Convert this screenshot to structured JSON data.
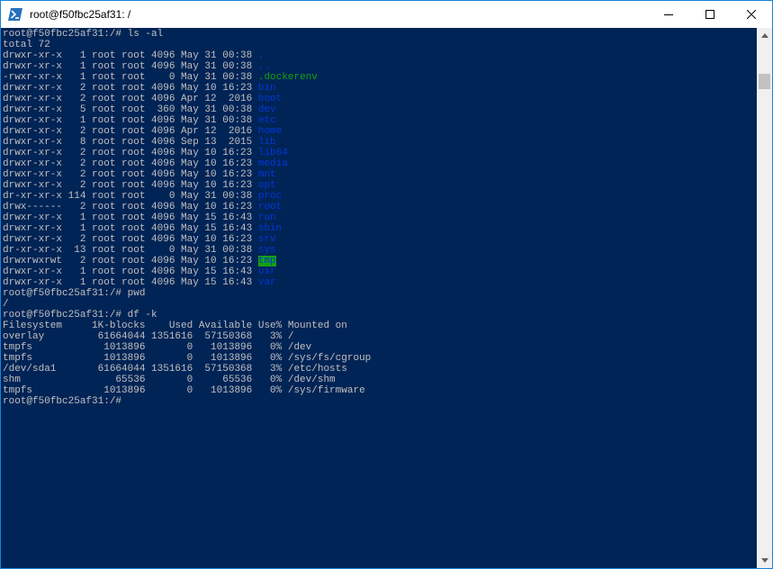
{
  "window": {
    "title": "root@f50fbc25af31: /"
  },
  "icons": {
    "app": "powershell-icon",
    "minimize": "minimize-icon",
    "maximize": "maximize-icon",
    "close": "close-icon",
    "scroll_up": "scroll-up-arrow-icon",
    "scroll_down": "scroll-down-arrow-icon"
  },
  "colors": {
    "terminal_bg": "#012456",
    "text": "#c0c0c0",
    "dir": "#0037da",
    "file": "#13a10e",
    "sticky_bg": "#13a10e"
  },
  "terminal": {
    "lines": [
      [
        "root@f50fbc25af31:/# ls -al"
      ],
      [
        "total 72"
      ],
      [
        "drwxr-xr-x   1 root root 4096 May 31 00:38 ",
        "."
      ],
      [
        "drwxr-xr-x   1 root root 4096 May 31 00:38 ",
        ".."
      ],
      [
        "-rwxr-xr-x   1 root root    0 May 31 00:38 ",
        ".dockerenv"
      ],
      [
        "drwxr-xr-x   2 root root 4096 May 10 16:23 ",
        "bin"
      ],
      [
        "drwxr-xr-x   2 root root 4096 Apr 12  2016 ",
        "boot"
      ],
      [
        "drwxr-xr-x   5 root root  360 May 31 00:38 ",
        "dev"
      ],
      [
        "drwxr-xr-x   1 root root 4096 May 31 00:38 ",
        "etc"
      ],
      [
        "drwxr-xr-x   2 root root 4096 Apr 12  2016 ",
        "home"
      ],
      [
        "drwxr-xr-x   8 root root 4096 Sep 13  2015 ",
        "lib"
      ],
      [
        "drwxr-xr-x   2 root root 4096 May 10 16:23 ",
        "lib64"
      ],
      [
        "drwxr-xr-x   2 root root 4096 May 10 16:23 ",
        "media"
      ],
      [
        "drwxr-xr-x   2 root root 4096 May 10 16:23 ",
        "mnt"
      ],
      [
        "drwxr-xr-x   2 root root 4096 May 10 16:23 ",
        "opt"
      ],
      [
        "dr-xr-xr-x 114 root root    0 May 31 00:38 ",
        "proc"
      ],
      [
        "drwx------   2 root root 4096 May 10 16:23 ",
        "root"
      ],
      [
        "drwxr-xr-x   1 root root 4096 May 15 16:43 ",
        "run"
      ],
      [
        "drwxr-xr-x   1 root root 4096 May 15 16:43 ",
        "sbin"
      ],
      [
        "drwxr-xr-x   2 root root 4096 May 10 16:23 ",
        "srv"
      ],
      [
        "dr-xr-xr-x  13 root root    0 May 31 00:38 ",
        "sys"
      ],
      [
        "drwxrwxrwt   2 root root 4096 May 10 16:23 ",
        "tmp"
      ],
      [
        "drwxr-xr-x   1 root root 4096 May 15 16:43 ",
        "usr"
      ],
      [
        "drwxr-xr-x   1 root root 4096 May 15 16:43 ",
        "var"
      ],
      [
        "root@f50fbc25af31:/# pwd"
      ],
      [
        "/"
      ],
      [
        "root@f50fbc25af31:/# df -k"
      ],
      [
        "Filesystem     1K-blocks    Used Available Use% Mounted on"
      ],
      [
        "overlay         61664044 1351616  57150368   3% /"
      ],
      [
        "tmpfs            1013896       0   1013896   0% /dev"
      ],
      [
        "tmpfs            1013896       0   1013896   0% /sys/fs/cgroup"
      ],
      [
        "/dev/sda1       61664044 1351616  57150368   3% /etc/hosts"
      ],
      [
        "shm                65536       0     65536   0% /dev/shm"
      ],
      [
        "tmpfs            1013896       0   1013896   0% /sys/firmware"
      ],
      [
        "root@f50fbc25af31:/# "
      ]
    ],
    "styles": [
      null,
      null,
      "dir",
      "dir",
      "file",
      "dir",
      "dir",
      "dir",
      "dir",
      "dir",
      "dir",
      "dir",
      "dir",
      "dir",
      "dir",
      "dir",
      "dir",
      "dir",
      "dir",
      "dir",
      "dir",
      "tmp",
      "dir",
      "dir",
      null,
      null,
      null,
      null,
      null,
      null,
      null,
      null,
      null,
      null,
      null
    ]
  }
}
